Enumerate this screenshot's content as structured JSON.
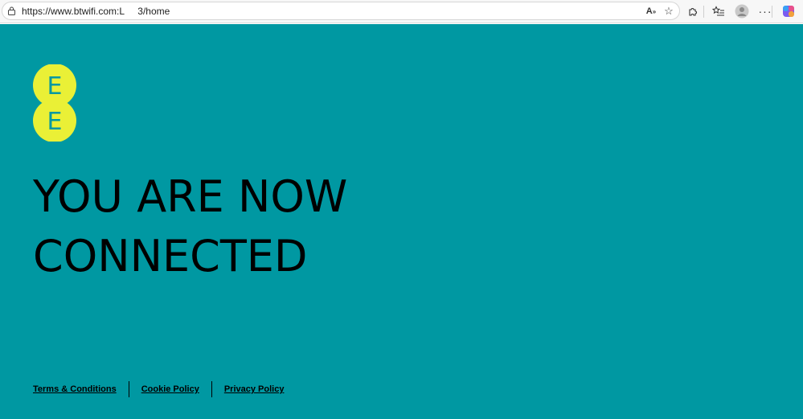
{
  "browser": {
    "url": "https://www.btwifi.com:L     3/home"
  },
  "header": {
    "logo_letters": [
      "E",
      "E"
    ]
  },
  "main": {
    "headline_lines": [
      "YOU ARE NOW",
      "CONNECTED"
    ]
  },
  "footer": {
    "links": [
      "Terms & Conditions",
      "Cookie Policy",
      "Privacy Policy"
    ]
  },
  "colors": {
    "page_background": "#0098a2",
    "logo_yellow": "#eaf036",
    "logo_letter": "#0098a2",
    "text": "#000000"
  },
  "icons": {
    "address_bar": "lock-icon",
    "toolbar": [
      "read-aloud-icon",
      "favorite-star-icon",
      "extensions-icon",
      "favorites-list-icon",
      "profile-icon",
      "more-icon",
      "copilot-icon"
    ]
  }
}
